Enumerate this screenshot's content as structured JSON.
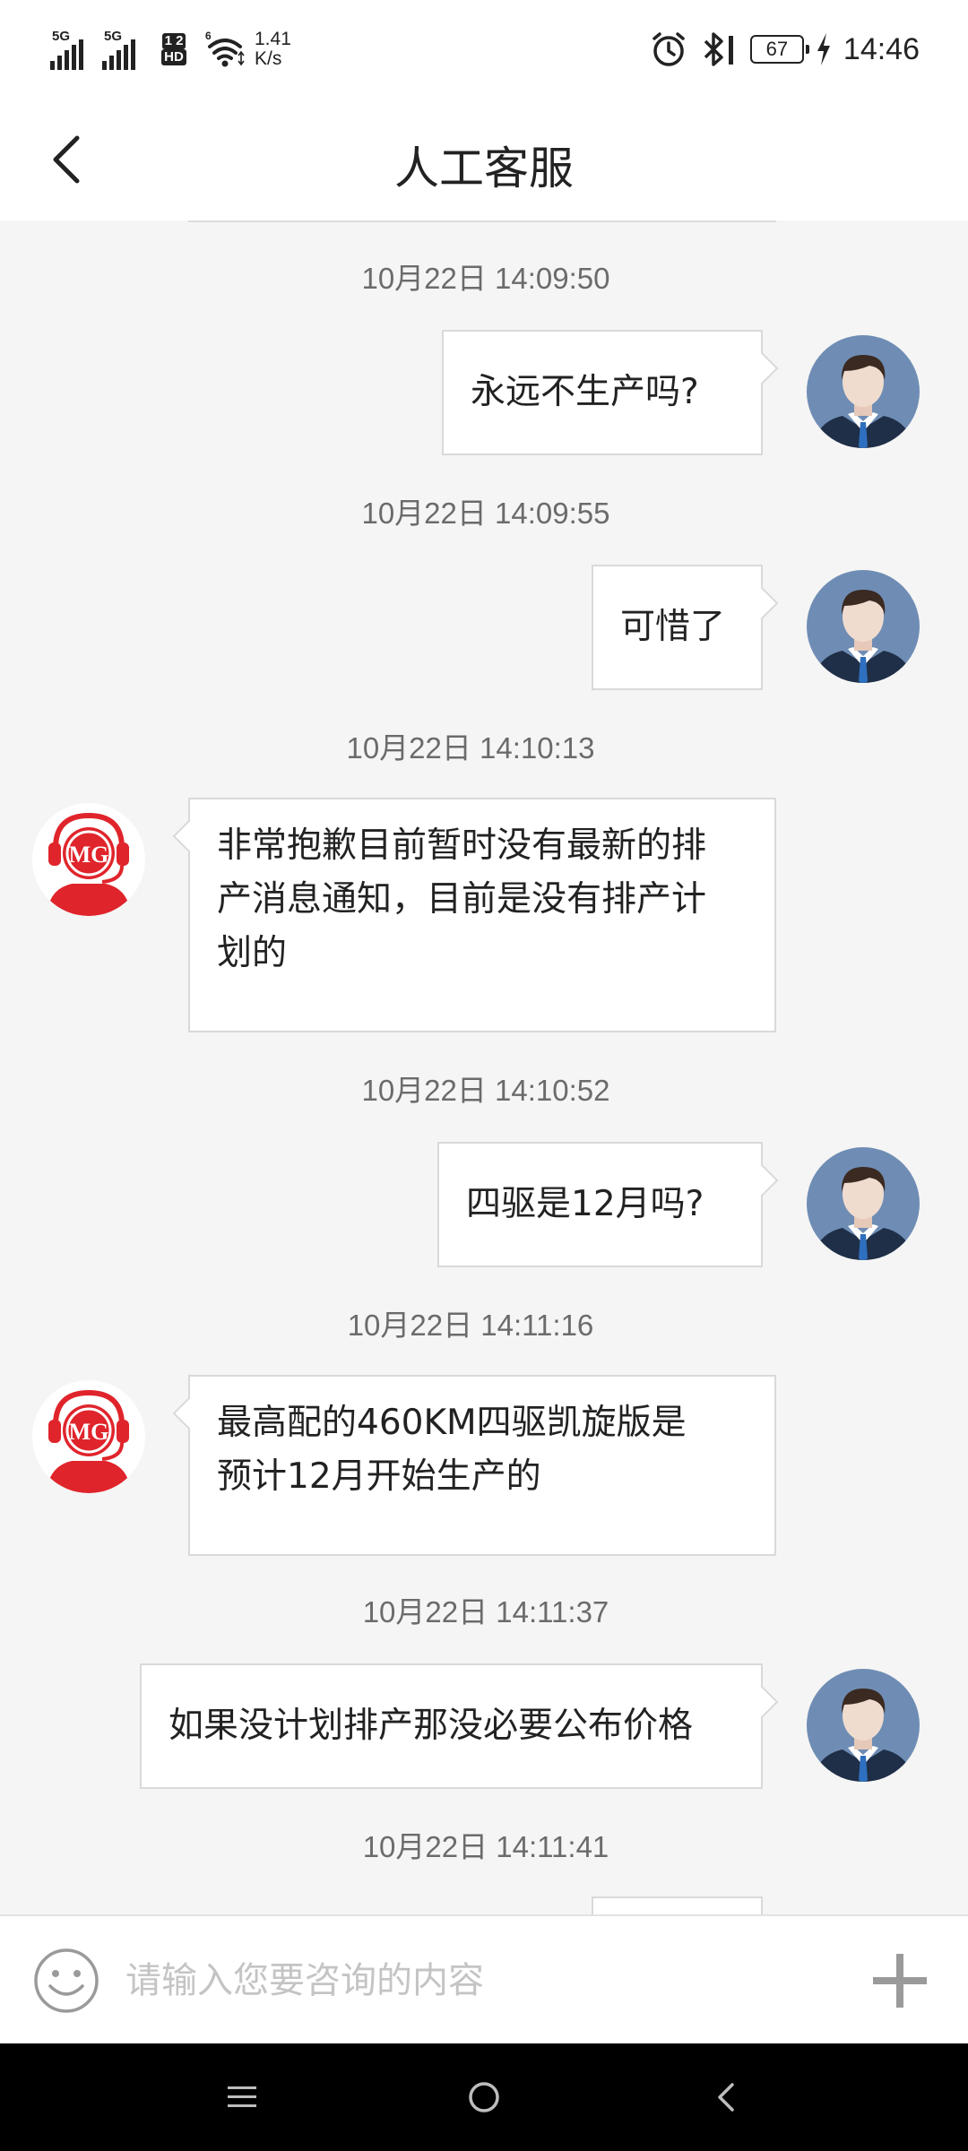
{
  "status_bar": {
    "signal1_label": "5G",
    "signal2_label": "5G",
    "hd_top": "1 2",
    "hd_bottom": "HD",
    "wifi_badge": "6",
    "net_speed_value": "1.41",
    "net_speed_unit": "K/s",
    "battery": "67",
    "time": "14:46",
    "icons": [
      "signal-icon",
      "signal-icon",
      "hd-icon",
      "wifi-icon",
      "alarm-icon",
      "bluetooth-icon",
      "battery-icon",
      "charging-icon"
    ]
  },
  "header": {
    "title": "人工客服",
    "back_icon": "chevron-left-icon"
  },
  "messages": [
    {
      "time": "10月22日 14:09:50",
      "from": "user",
      "text": "永远不生产吗?"
    },
    {
      "time": "10月22日 14:09:55",
      "from": "user",
      "text": "可惜了"
    },
    {
      "time": "10月22日 14:10:13",
      "from": "agent",
      "lines": [
        "非常抱歉目前暂时没有最新的排",
        "产消息通知，目前是没有排产计",
        "划的"
      ]
    },
    {
      "time": "10月22日 14:10:52",
      "from": "user",
      "text": "四驱是12月吗?"
    },
    {
      "time": "10月22日 14:11:16",
      "from": "agent",
      "lines": [
        "最高配的460KM四驱凯旋版是",
        "预计12月开始生产的"
      ]
    },
    {
      "time": "10月22日 14:11:37",
      "from": "user",
      "text": "如果没计划排产那没必要公布价格"
    },
    {
      "time": "10月22日 14:11:41",
      "from": "user",
      "text": ""
    }
  ],
  "agent_logo_text": "MG",
  "input": {
    "placeholder": "请输入您要咨询的内容",
    "value": ""
  },
  "colors": {
    "accent_red": "#e0242b",
    "avatar_bg": "#6f8db4",
    "bubble_border": "#d9d9d9",
    "background": "#f5f5f5"
  },
  "nav": [
    "menu-icon",
    "home-icon",
    "back-icon"
  ]
}
